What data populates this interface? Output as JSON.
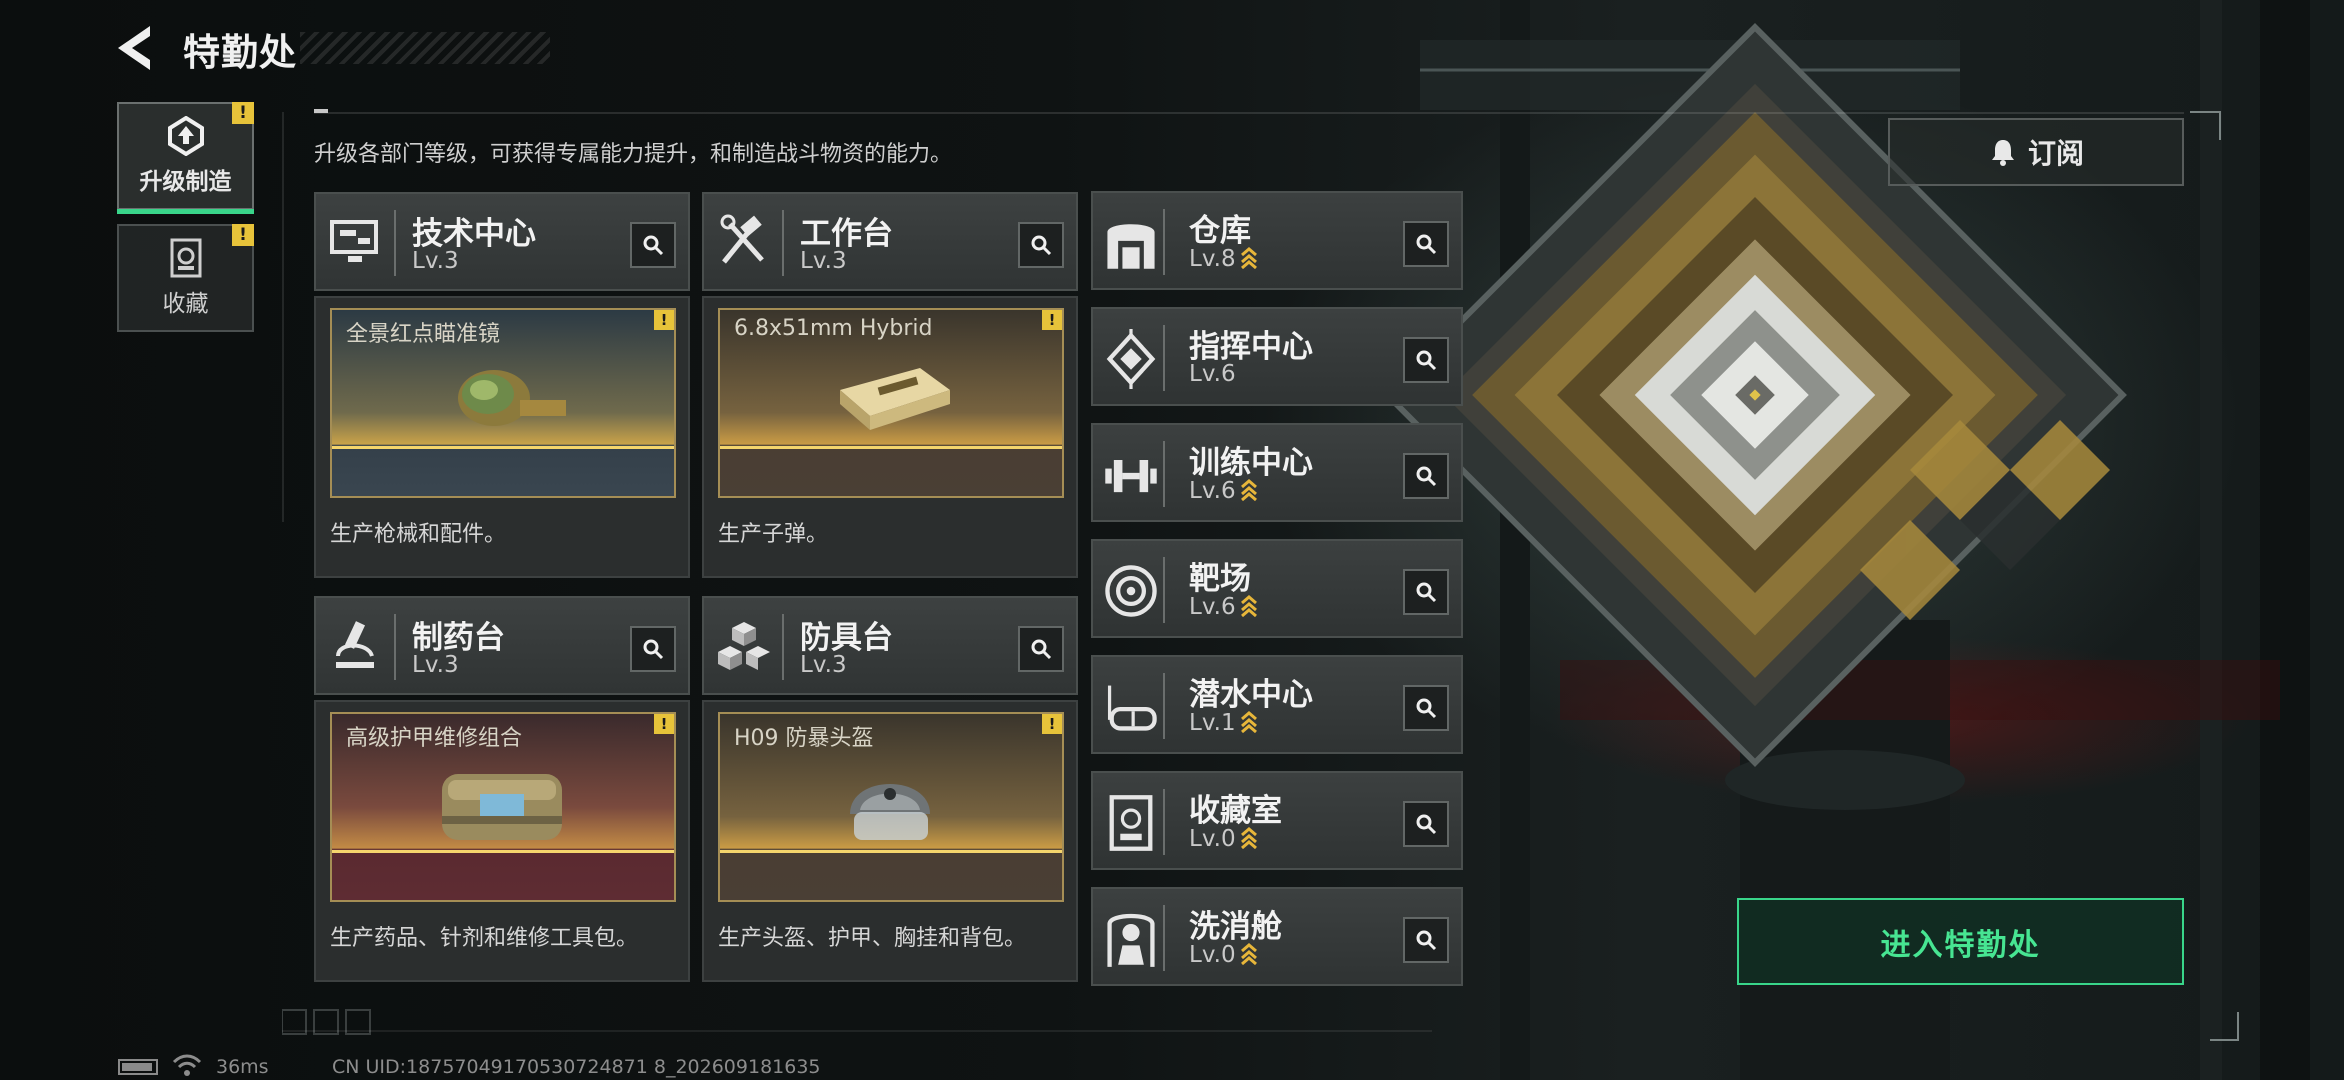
{
  "header": {
    "title": "特勤处"
  },
  "nav": [
    {
      "label": "升级制造",
      "active": true,
      "alert": "!"
    },
    {
      "label": "收藏",
      "active": false,
      "alert": "!"
    }
  ],
  "description": "升级各部门等级，可获得专属能力提升，和制造战斗物资的能力。",
  "subscribe": {
    "label": "订阅"
  },
  "cards": [
    {
      "name": "技术中心",
      "level": "Lv.3",
      "item": "全景红点瞄准镜",
      "desc": "生产枪械和配件。",
      "alert": "!",
      "icon": "monitor-icon"
    },
    {
      "name": "工作台",
      "level": "Lv.3",
      "item": "6.8x51mm Hybrid",
      "desc": "生产子弹。",
      "alert": "!",
      "icon": "tools-icon"
    },
    {
      "name": "制药台",
      "level": "Lv.3",
      "item": "高级护甲维修组合",
      "desc": "生产药品、针剂和维修工具包。",
      "alert": "!",
      "icon": "microscope-icon"
    },
    {
      "name": "防具台",
      "level": "Lv.3",
      "item": "H09 防暴头盔",
      "desc": "生产头盔、护甲、胸挂和背包。",
      "alert": "!",
      "icon": "cubes-icon"
    }
  ],
  "facilities": [
    {
      "name": "仓库",
      "level": "Lv.8",
      "icon": "warehouse-icon"
    },
    {
      "name": "指挥中心",
      "level": "Lv.6",
      "icon": "chip-icon"
    },
    {
      "name": "训练中心",
      "level": "Lv.6",
      "icon": "dumbbell-icon"
    },
    {
      "name": "靶场",
      "level": "Lv.6",
      "icon": "target-icon"
    },
    {
      "name": "潜水中心",
      "level": "Lv.1",
      "icon": "diving-mask-icon"
    },
    {
      "name": "收藏室",
      "level": "Lv.0",
      "icon": "collection-icon"
    },
    {
      "name": "洗消舱",
      "level": "Lv.0",
      "icon": "hazmat-icon"
    }
  ],
  "enter": {
    "label": "进入特勤处"
  },
  "status": {
    "ping": "36ms",
    "uid": "CN UID:18757049170530724871 8_202609181635"
  },
  "colors": {
    "accent_green": "#39d58a",
    "alert_yellow": "#e7c33a",
    "upgrade_gold": "#e7b63a"
  }
}
